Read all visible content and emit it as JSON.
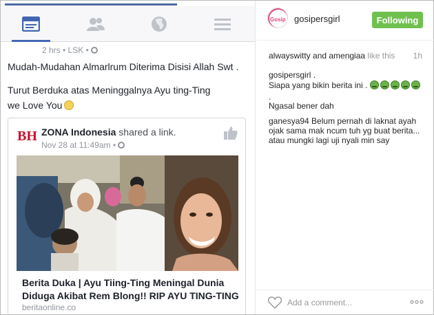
{
  "facebook": {
    "post_meta": "2 hrs • LSK • ",
    "text_line1": "Mudah-Mudahan Almarlrum Diterima Disisi Allah Swt .",
    "text_line2": "Turut Berduka atas Meninggalnya Ayu ting-Ting",
    "text_line3": "we Love You",
    "shared_page": "ZONA Indonesia",
    "shared_action": " shared a link.",
    "shared_date": "Nov 28 at 11:49am • ",
    "link_title_line1": "Berita Duka | Ayu Tiing-Ting Meningal Dunia",
    "link_title_line2": "Diduga Akibat Rem Blong!! RIP AYU TING-TING",
    "link_domain": "beritaonline.co",
    "tabs": [
      "news-feed-icon",
      "friends-icon",
      "globe-icon",
      "menu-icon"
    ]
  },
  "instagram": {
    "username": "gosipersgirl",
    "follow_label": "Following",
    "likes_users": "alwayswitty and amengiaa",
    "likes_suffix": " like this",
    "time": "1h",
    "caption_user": "gosipersgirl .",
    "caption_line": "Siapa yang bikin berita ini .",
    "caption_dot": ".",
    "caption_comment": "Ngasal bener dah",
    "comment_user": "ganesya94",
    "comment_line1": " Belum pernah di laknat ayah",
    "comment_line2": "ojak sama mak ncum tuh yg buat berita...",
    "comment_line3": "atau mungki lagi uji nyali min say",
    "add_comment_placeholder": "Add a comment...",
    "avatar_text": "Gosip"
  },
  "colors": {
    "fb_blue": "#4267b2",
    "follow_green": "#70c050",
    "text_dark": "#1d2129",
    "muted": "#90949c"
  }
}
